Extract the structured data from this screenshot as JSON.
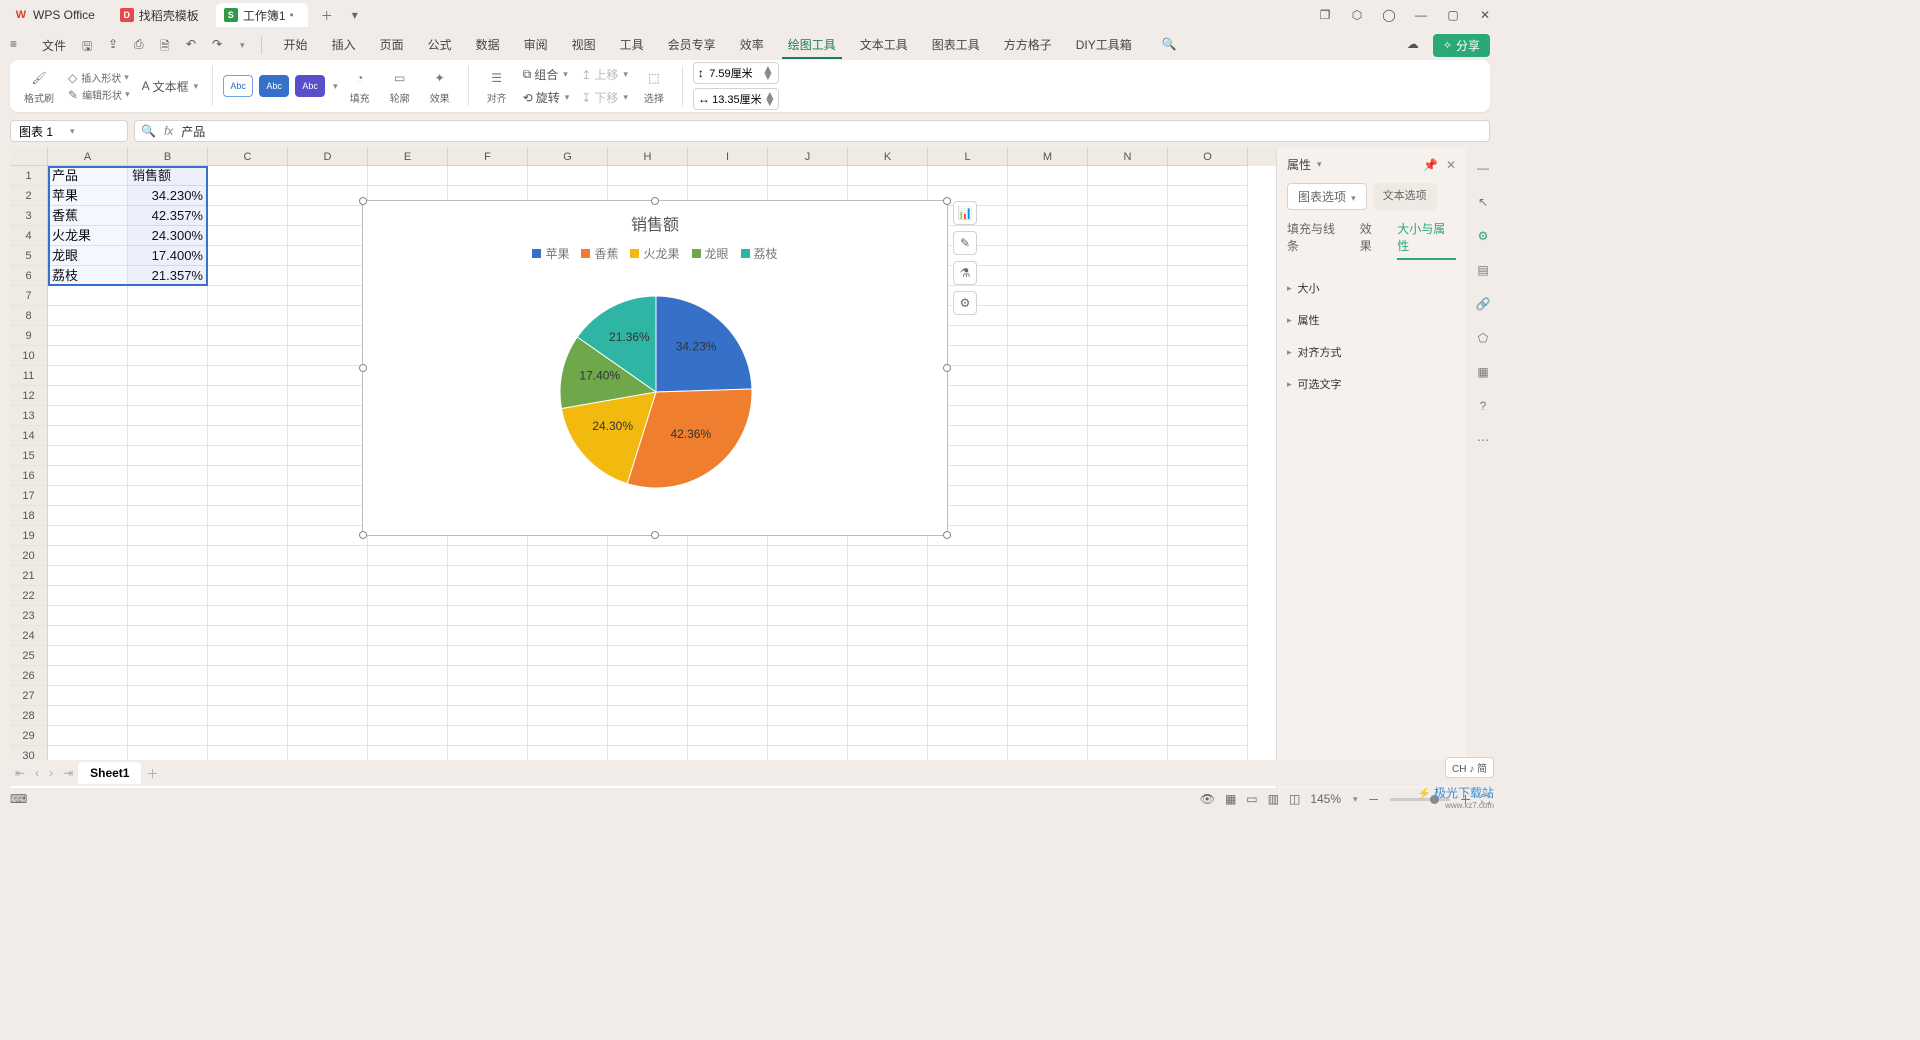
{
  "titlebar": {
    "tabs": [
      {
        "icon": "W",
        "label": "WPS Office"
      },
      {
        "icon": "D",
        "label": "找稻壳模板"
      },
      {
        "icon": "S",
        "label": "工作簿1",
        "dirty": "•"
      }
    ]
  },
  "menubar": {
    "file": "文件",
    "items": [
      "开始",
      "插入",
      "页面",
      "公式",
      "数据",
      "审阅",
      "视图",
      "工具",
      "会员专享",
      "效率",
      "绘图工具",
      "文本工具",
      "图表工具",
      "方方格子",
      "DIY工具箱"
    ],
    "activeIndex": 10,
    "share": "分享"
  },
  "ribbon": {
    "g1": [
      "格式刷",
      "插入形状",
      "编辑形状"
    ],
    "textbox": "文本框",
    "styles": [
      "Abc",
      "Abc",
      "Abc"
    ],
    "g3": [
      "填充",
      "轮廓",
      "效果"
    ],
    "g4": [
      "对齐",
      "组合",
      "上移",
      "下移",
      "旋转",
      "选择"
    ],
    "height": "7.59厘米",
    "width": "13.35厘米"
  },
  "namebox": "图表 1",
  "formula": "产品",
  "columns": [
    "A",
    "B",
    "C",
    "D",
    "E",
    "F",
    "G",
    "H",
    "I",
    "J",
    "K",
    "L",
    "M",
    "N",
    "O"
  ],
  "rowcount": 30,
  "cells": {
    "A1": "产品",
    "B1": "销售额",
    "A2": "苹果",
    "B2": "34.230%",
    "A3": "香蕉",
    "B3": "42.357%",
    "A4": "火龙果",
    "B4": "24.300%",
    "A5": "龙眼",
    "B5": "17.400%",
    "A6": "荔枝",
    "B6": "21.357%"
  },
  "chart_data": {
    "type": "pie",
    "title": "销售额",
    "categories": [
      "苹果",
      "香蕉",
      "火龙果",
      "龙眼",
      "荔枝"
    ],
    "values": [
      34.23,
      42.36,
      24.3,
      17.4,
      21.36
    ],
    "colors": [
      "#3571c9",
      "#ef7f2e",
      "#f2b90f",
      "#6ea84b",
      "#2fb5a3"
    ],
    "labels": [
      "34.23%",
      "42.36%",
      "24.30%",
      "17.40%",
      "21.36%"
    ]
  },
  "props": {
    "title": "属性",
    "toggle": [
      "图表选项",
      "文本选项"
    ],
    "tabs": [
      "填充与线条",
      "效果",
      "大小与属性"
    ],
    "sections": [
      "大小",
      "属性",
      "对齐方式",
      "可选文字"
    ]
  },
  "sheet": "Sheet1",
  "zoom": "145%",
  "ime": "CH ♪ 简",
  "watermark": "极光下载站"
}
